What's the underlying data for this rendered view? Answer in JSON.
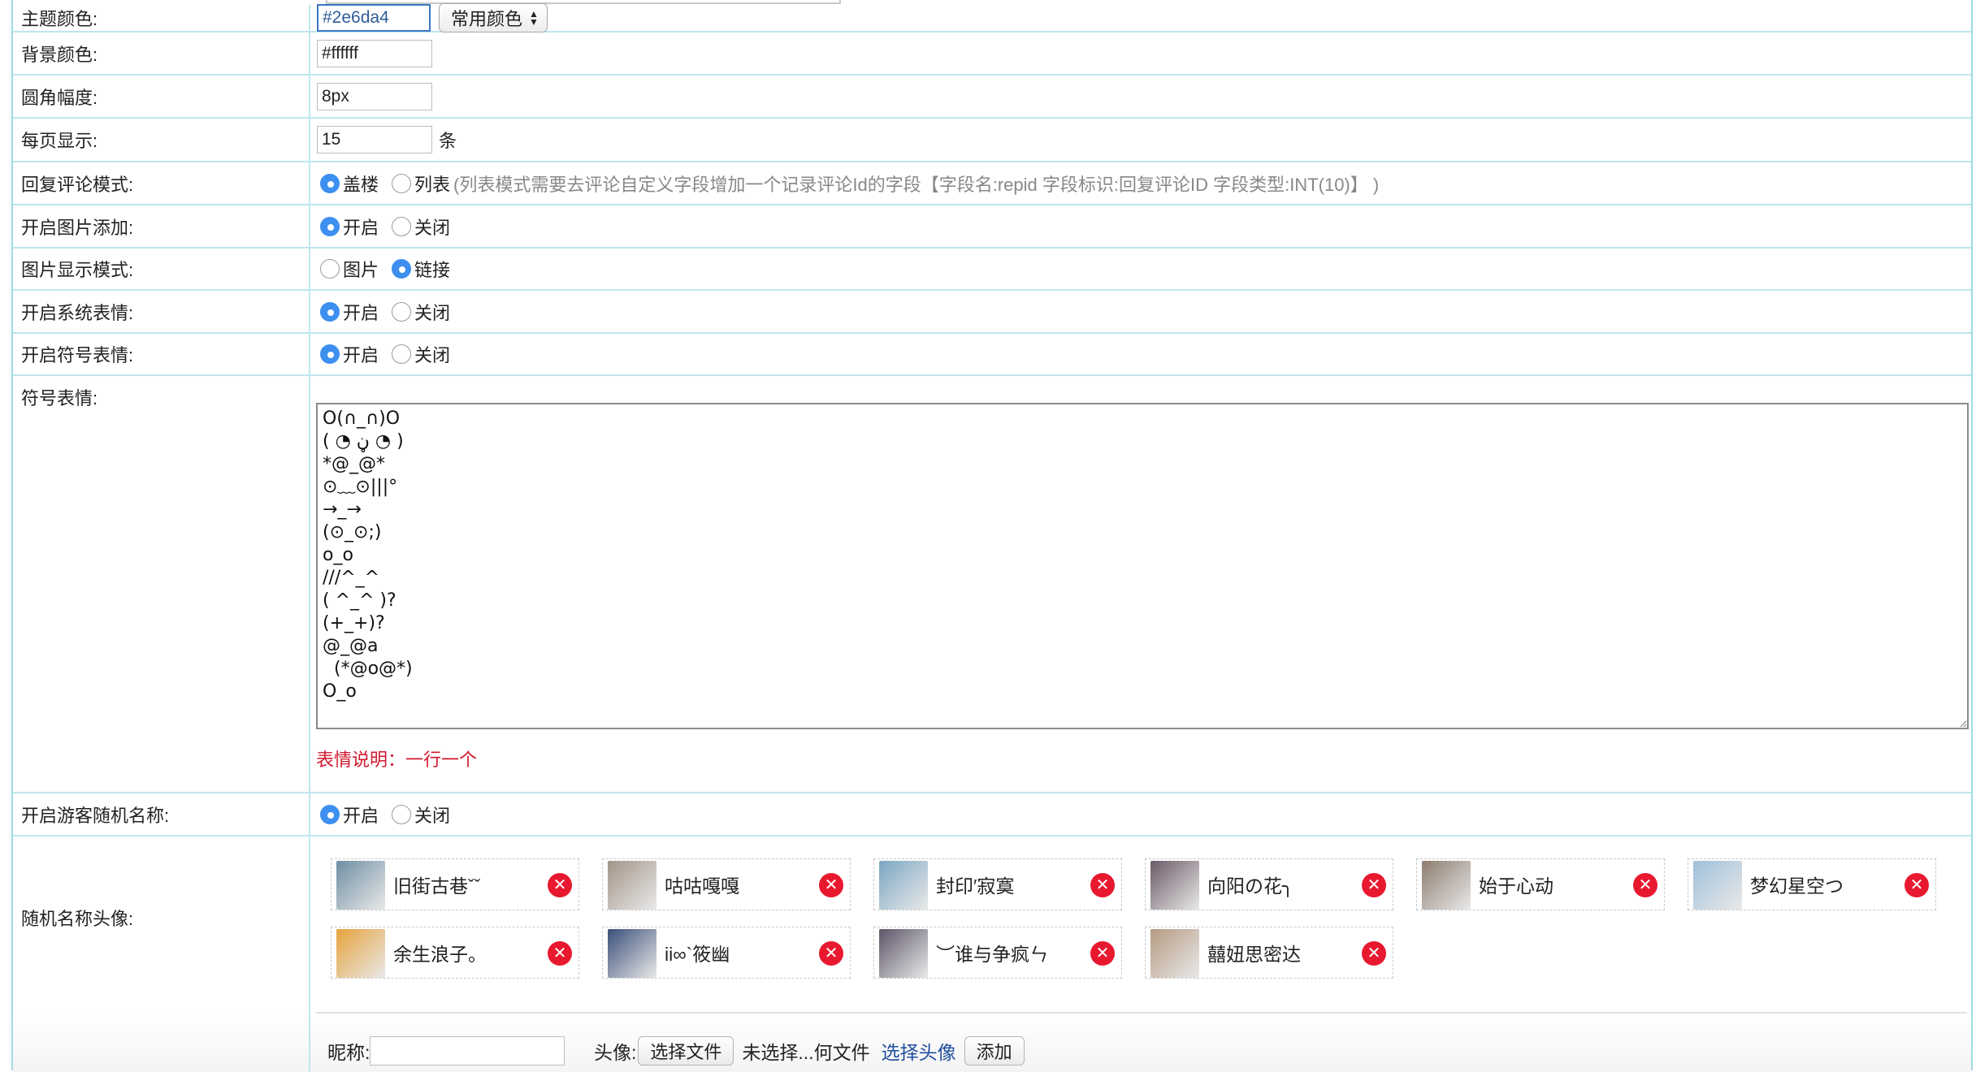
{
  "settings": {
    "theme_color": {
      "label": "主题颜色:",
      "value": "#2e6da4",
      "select": "常用颜色"
    },
    "bg_color": {
      "label": "背景颜色:",
      "value": "#ffffff"
    },
    "radius": {
      "label": "圆角幅度:",
      "value": "8px"
    },
    "per_page": {
      "label": "每页显示:",
      "value": "15",
      "unit": "条"
    },
    "reply_mode": {
      "label": "回复评论模式:",
      "opt1": "盖楼",
      "opt2": "列表",
      "hint": "(列表模式需要去评论自定义字段增加一个记录评论Id的字段【字段名:repid 字段标识:回复评论ID 字段类型:INT(10)】 )",
      "selected": 1
    },
    "img_add": {
      "label": "开启图片添加:",
      "opt1": "开启",
      "opt2": "关闭",
      "selected": 1
    },
    "img_mode": {
      "label": "图片显示模式:",
      "opt1": "图片",
      "opt2": "链接",
      "selected": 2
    },
    "sys_emoji": {
      "label": "开启系统表情:",
      "opt1": "开启",
      "opt2": "关闭",
      "selected": 1
    },
    "sym_emoji": {
      "label": "开启符号表情:",
      "opt1": "开启",
      "opt2": "关闭",
      "selected": 1
    },
    "emoji_text": {
      "label": "符号表情:",
      "content": "O(∩_∩)O\n( ◔ ڼ ◔ )\n*@_@*\n⊙﹏⊙|||°\n→_→\n(⊙_⊙;)\no_o\n///^_^\n( ^_^ )?\n(+_+)?\n@_@a\n  (*@o@*)\nO_o",
      "note": "表情说明：一行一个"
    },
    "guest_name": {
      "label": "开启游客随机名称:",
      "opt1": "开启",
      "opt2": "关闭",
      "selected": 1
    },
    "avatars": {
      "label": "随机名称头像:",
      "items": [
        {
          "name": "旧街古巷ˇˇ",
          "color": "#6f8fa3"
        },
        {
          "name": "咕咕嘎嘎",
          "color": "#a39488"
        },
        {
          "name": "封印′寂寞",
          "color": "#7aa7c2"
        },
        {
          "name": "向阳の花╮",
          "color": "#6b5a66"
        },
        {
          "name": "始于心动",
          "color": "#8e7d70"
        },
        {
          "name": "梦幻星空つ",
          "color": "#9fbfd9"
        },
        {
          "name": "余生浪子。",
          "color": "#e6a23c"
        },
        {
          "name": "ii∞`筱幽",
          "color": "#3a4f7a"
        },
        {
          "name": "︶谁与争疯ㄣ",
          "color": "#5c5568"
        },
        {
          "name": "囍妞思密达",
          "color": "#b59a82"
        }
      ],
      "delete_symbol": "✕"
    },
    "add_form": {
      "nick_label": "昵称:",
      "avatar_label": "头像:",
      "choose_file": "选择文件",
      "no_file": "未选择...何文件",
      "choose_avatar": "选择头像",
      "add_button": "添加"
    }
  }
}
